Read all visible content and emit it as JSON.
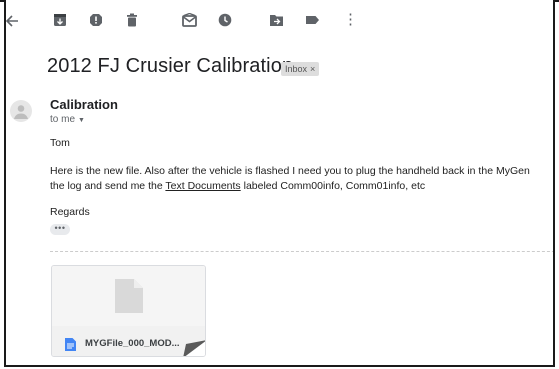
{
  "toolbar": {
    "icons": [
      "back-arrow-icon",
      "archive-icon",
      "report-spam-icon",
      "delete-icon",
      "mark-unread-icon",
      "snooze-icon",
      "move-to-icon",
      "label-icon",
      "more-vert-icon"
    ],
    "more_glyph": "⋮"
  },
  "email": {
    "subject": "2012 FJ Crusier Calibration",
    "label_chip": "Inbox",
    "label_chip_close": "×",
    "sender": "Calibration",
    "recipient": "to me",
    "recipient_caret": "▼",
    "greeting": "Tom",
    "body_line1": "Here is the new file.  Also after the vehicle is flashed I need you to plug the handheld back in the MyGen",
    "body_line2_pre": "the log and send me the ",
    "body_link": "Text Documents",
    "body_line2_post": " labeled Comm00info, Comm01info, etc",
    "signoff": "Regards",
    "trimmed_glyph": "•••"
  },
  "attachment": {
    "filename": "MYGFile_000_MOD...",
    "icon": "document-icon"
  },
  "colors": {
    "toolbar_icon": "#5f6368",
    "chip_bg": "#dddddd",
    "file_icon": "#4285f4"
  }
}
